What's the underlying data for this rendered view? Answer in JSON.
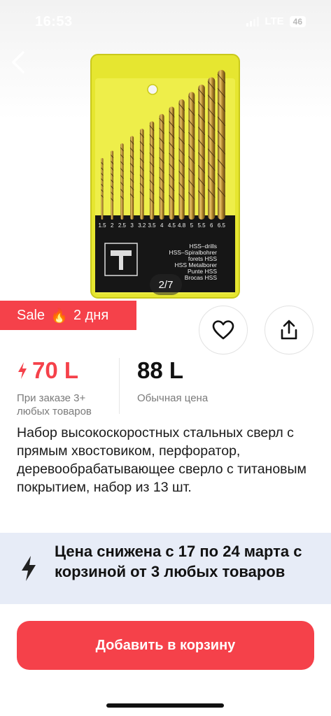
{
  "status_bar": {
    "time": "16:53",
    "network": "LTE",
    "battery": "46"
  },
  "gallery": {
    "pager": "2/7",
    "package_labels": {
      "sizes": [
        "1.5",
        "2",
        "2.5",
        "3",
        "3.2",
        "3.5",
        "4",
        "4.5",
        "4.8",
        "5",
        "5.5",
        "6",
        "6.5"
      ],
      "lines": [
        "HSS–drills",
        "HSS–Spiralbohrer",
        "forets HSS",
        "HSS Metalborer",
        "Punte HSS",
        "Brocas HSS"
      ]
    }
  },
  "sale_badge": {
    "label": "Sale",
    "duration": "2 дня"
  },
  "prices": {
    "special_price": "70 L",
    "special_note": "При заказе 3+ любых товаров",
    "regular_price": "88 L",
    "regular_note": "Обычная цена"
  },
  "product": {
    "title": "Набор высокоскоростных стальных сверл с прямым хвостовиком, перфоратор, деревообрабатывающее сверло с титановым покрытием, набор из 13 шт."
  },
  "promo": {
    "text": "Цена снижена с 17 по 24 марта с корзиной от 3 любых товаров"
  },
  "actions": {
    "add_to_cart": "Добавить в корзину"
  },
  "icons": {
    "back": "chevron-left-icon",
    "favorite": "heart-icon",
    "share": "share-icon",
    "lightning": "lightning-icon",
    "flame": "fire-icon"
  },
  "colors": {
    "accent": "#f5414a",
    "promo_bg": "#e7ecf7",
    "package_yellow": "#e8e832"
  }
}
